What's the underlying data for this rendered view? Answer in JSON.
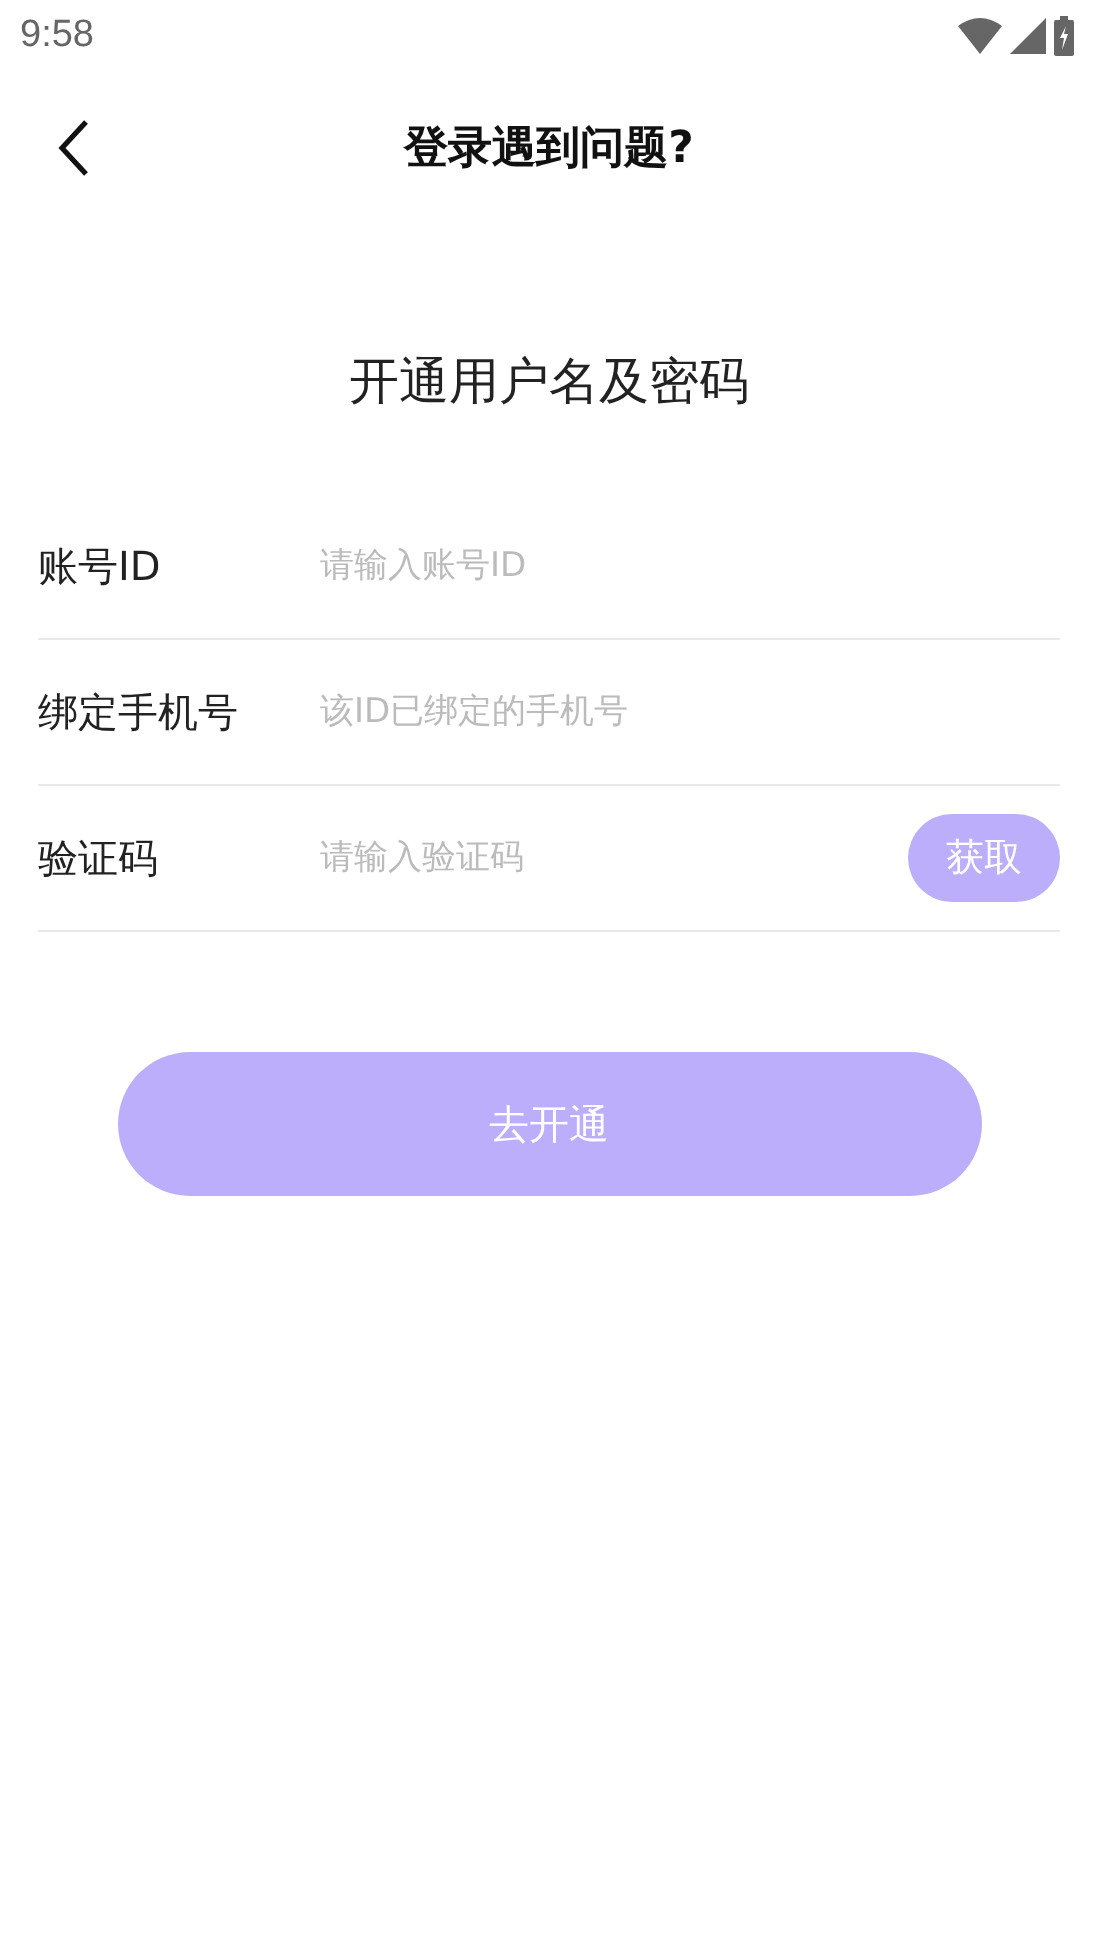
{
  "status_bar": {
    "time": "9:58"
  },
  "header": {
    "title": "登录遇到问题?"
  },
  "heading": "开通用户名及密码",
  "fields": [
    {
      "label": "账号ID",
      "placeholder": "请输入账号ID"
    },
    {
      "label": "绑定手机号",
      "placeholder": "该ID已绑定的手机号"
    },
    {
      "label": "验证码",
      "placeholder": "请输入验证码",
      "button": "获取"
    }
  ],
  "submit": "去开通"
}
